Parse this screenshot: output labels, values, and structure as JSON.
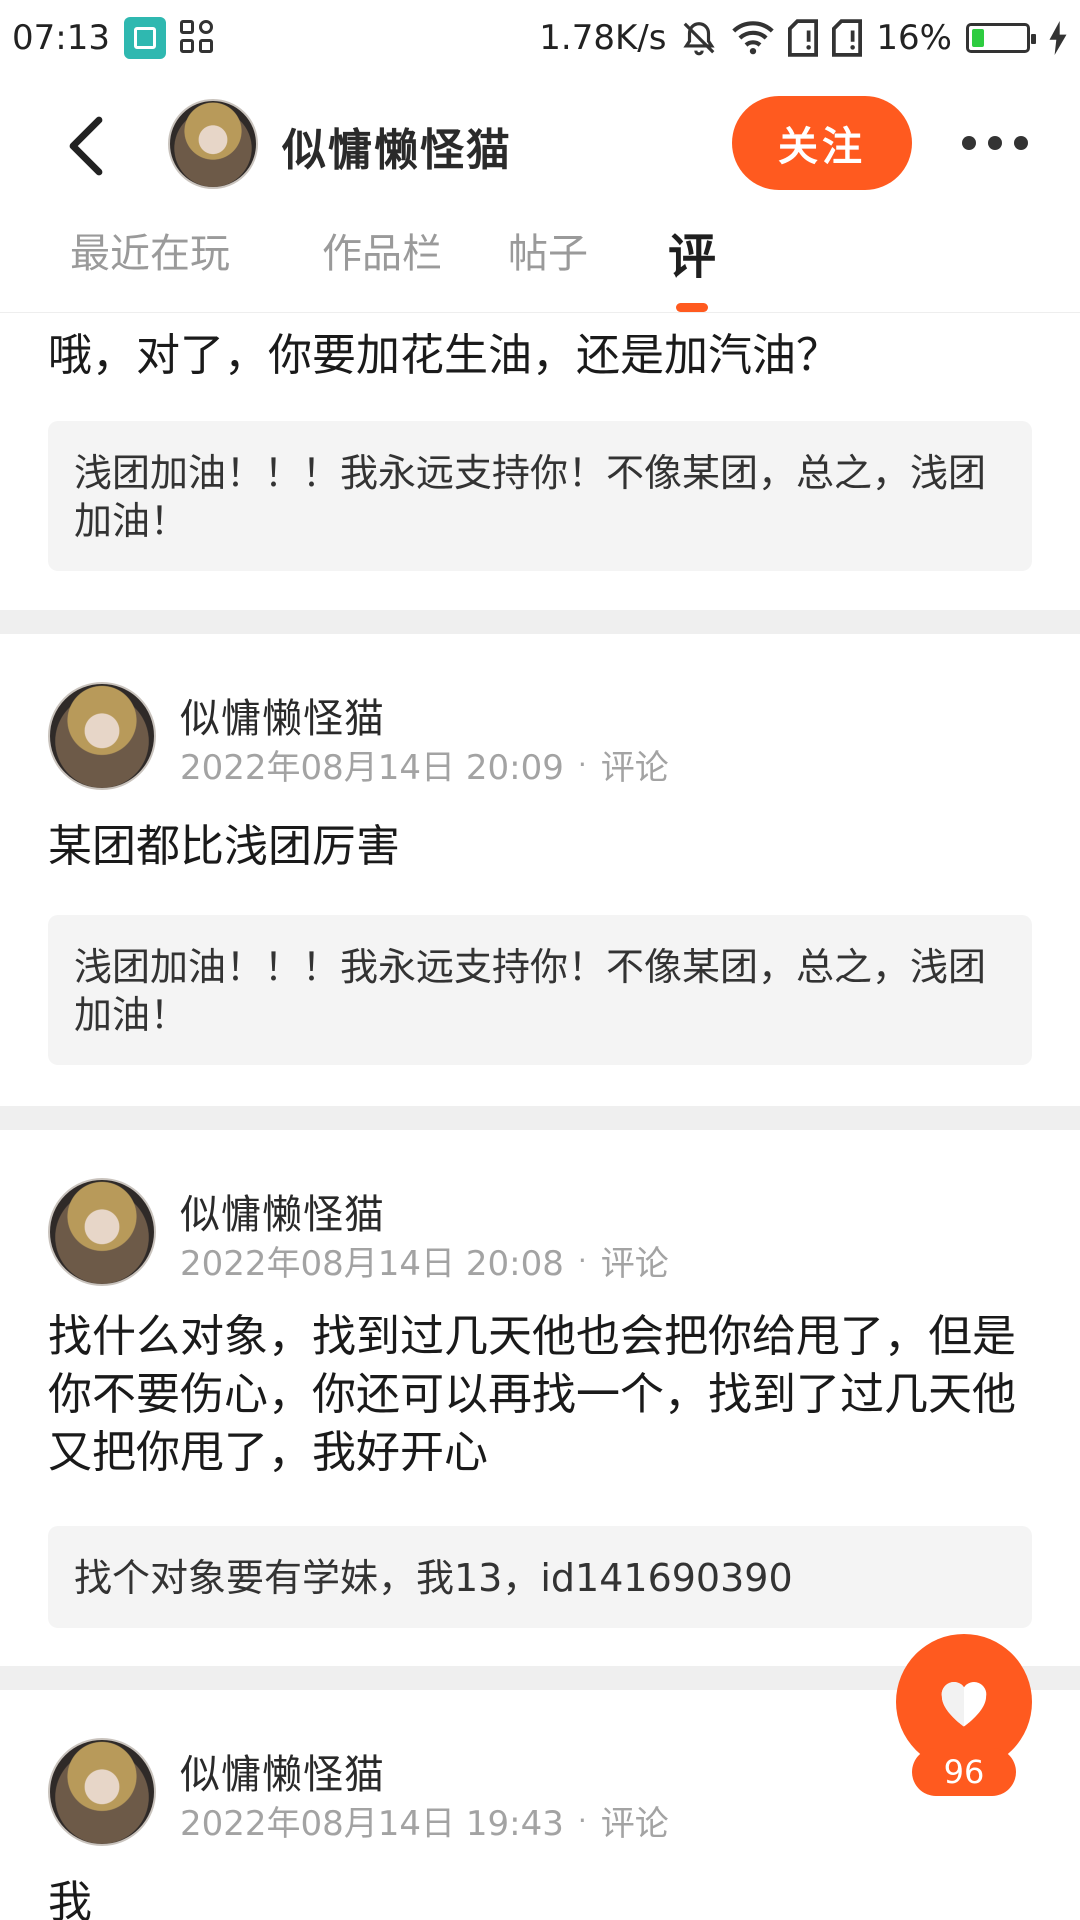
{
  "status_bar": {
    "time": "07:13",
    "net_speed": "1.78K/s",
    "battery": "16%",
    "battery_level": 0.16,
    "icons": [
      "screen-capture-icon",
      "apps-grid-icon",
      "bell-muted-icon",
      "wifi-icon",
      "sim1-icon",
      "sim2-icon",
      "battery-icon",
      "charging-icon"
    ]
  },
  "header": {
    "title": "似慵懒怪猫",
    "follow_label": "关注"
  },
  "tabs": [
    {
      "label": "最近在玩"
    },
    {
      "label": "作品栏"
    },
    {
      "label": "帖子"
    },
    {
      "label": "评"
    }
  ],
  "feed": {
    "top_partial": {
      "text": "哦，对了，你要加花生油，还是加汽油？",
      "quote": "浅团加油！！！我永远支持你！不像某团，总之，浅团加油！"
    },
    "items": [
      {
        "name": "似慵懒怪猫",
        "time": "2022年08月14日 20:09",
        "dot": "·",
        "type": "评论",
        "text": "某团都比浅团厉害",
        "quote": "浅团加油！！！我永远支持你！不像某团，总之，浅团加油！"
      },
      {
        "name": "似慵懒怪猫",
        "time": "2022年08月14日 20:08",
        "dot": "·",
        "type": "评论",
        "text": "找什么对象，找到过几天他也会把你给甩了，但是你不要伤心，你还可以再找一个，找到了过几天他又把你甩了，我好开心",
        "quote": "找个对象要有学妹，我13，id141690390"
      },
      {
        "name": "似慵懒怪猫",
        "time": "2022年08月14日 19:43",
        "dot": "·",
        "type": "评论",
        "text": "我"
      }
    ]
  },
  "like": {
    "count": "96"
  },
  "colors": {
    "accent": "#ff5a1f",
    "divider": "#efefef",
    "quote_bg": "#f4f4f4",
    "meta": "#a3a3a3"
  }
}
